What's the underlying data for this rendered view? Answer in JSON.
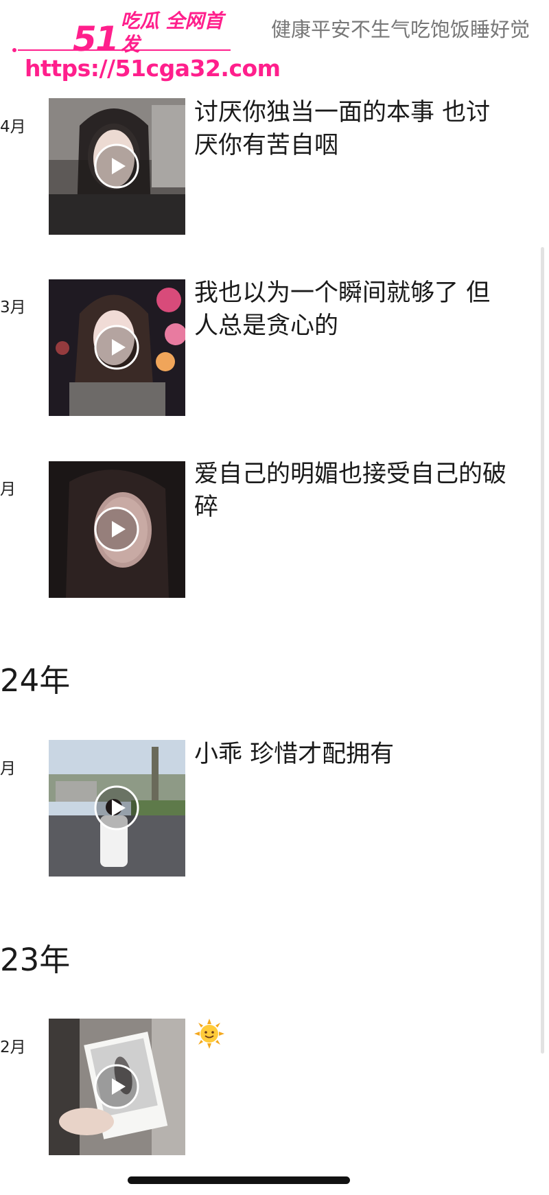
{
  "watermark": {
    "number": "51",
    "tagline": "吃瓜 全网首发",
    "url": "https://51cga32.com"
  },
  "profile": {
    "signature": "健康平安不生气吃饱饭睡好觉"
  },
  "years": [
    "24年",
    "23年"
  ],
  "posts": [
    {
      "month": "4月",
      "caption": "讨厌你独当一面的本事 也讨厌你有苦自咽"
    },
    {
      "month": "3月",
      "caption": "我也以为一个瞬间就够了 但人总是贪心的"
    },
    {
      "month": "月",
      "caption": "爱自己的明媚也接受自己的破碎"
    },
    {
      "month": "月",
      "caption": "小乖 珍惜才配拥有"
    },
    {
      "month": "2月",
      "caption": "",
      "emoji": "sun-with-face"
    }
  ],
  "colors": {
    "watermark": "#ff1f8c",
    "signature": "#777777"
  }
}
